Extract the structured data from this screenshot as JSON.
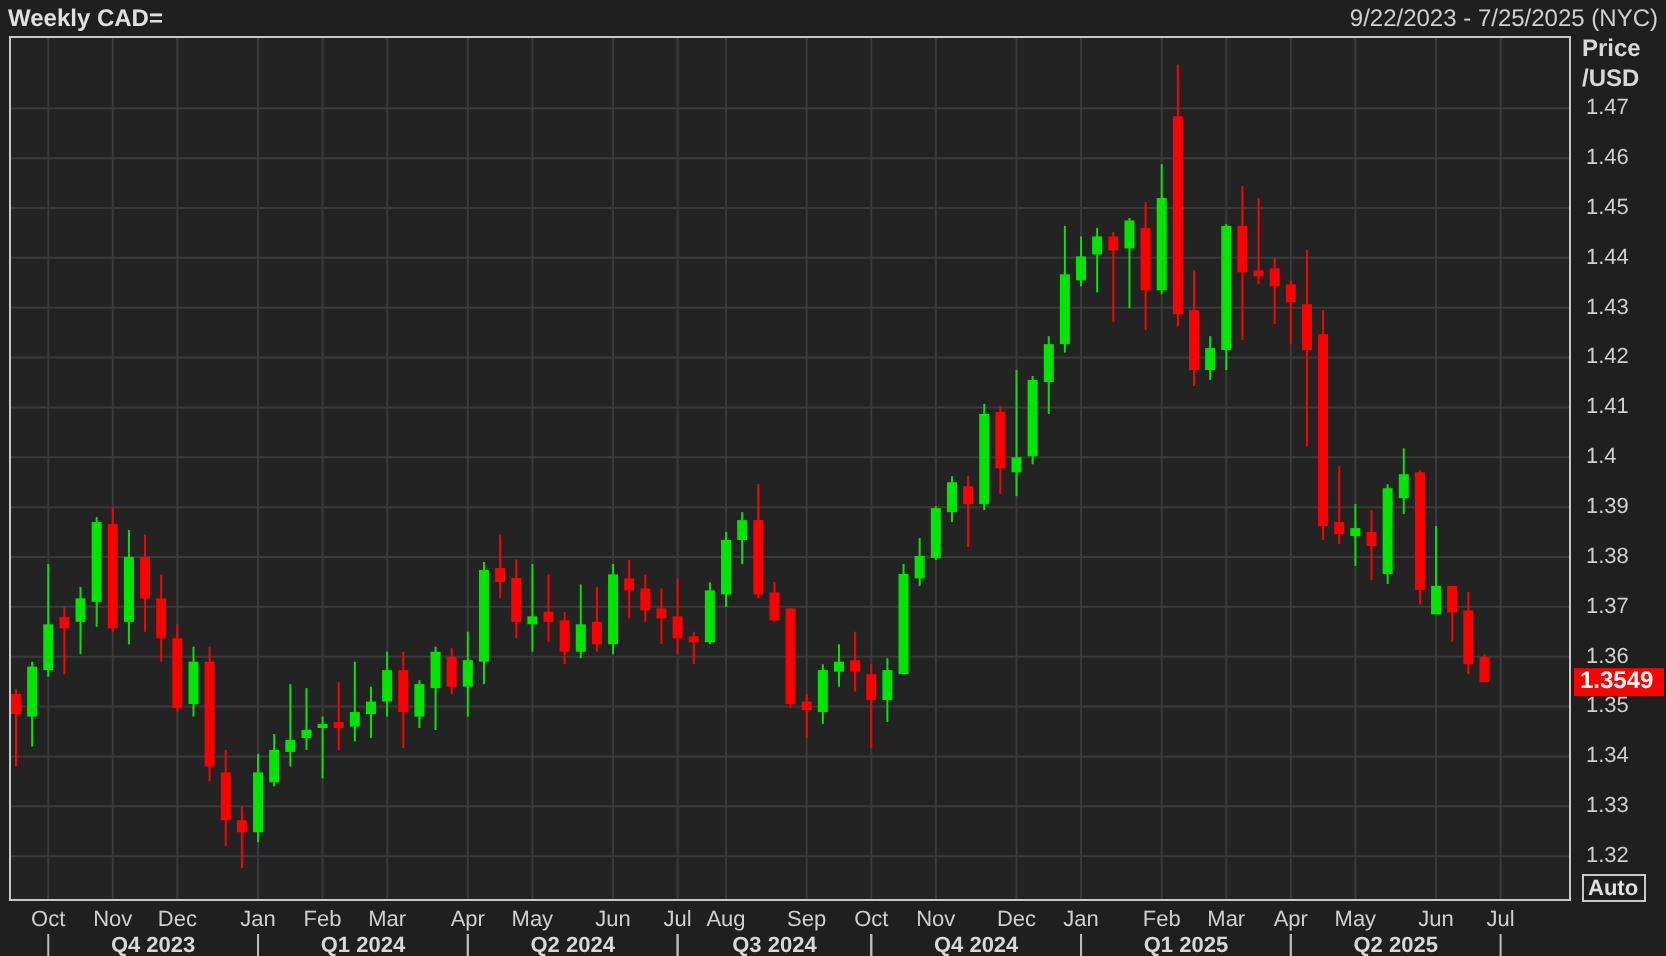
{
  "header": {
    "title": "Weekly CAD=",
    "date_range": "9/22/2023 - 7/25/2025 (NYC)"
  },
  "chart": {
    "auto_button": "Auto",
    "last_price": "1.3549",
    "quarters": [
      "Q4 2023",
      "Q1 2024",
      "Q2 2024",
      "Q3 2024",
      "Q4 2024",
      "Q1 2025",
      "Q2 2025"
    ],
    "chart_data": {
      "type": "candlestick",
      "ylabel": "Price /USD",
      "grid": true,
      "ylim": [
        1.3112,
        1.4845
      ],
      "yticks": [
        {
          "value": 1.32,
          "label": "1.32"
        },
        {
          "value": 1.33,
          "label": "1.33"
        },
        {
          "value": 1.34,
          "label": "1.34"
        },
        {
          "value": 1.35,
          "label": "1.35"
        },
        {
          "value": 1.36,
          "label": "1.36"
        },
        {
          "value": 1.37,
          "label": "1.37"
        },
        {
          "value": 1.38,
          "label": "1.38"
        },
        {
          "value": 1.39,
          "label": "1.39"
        },
        {
          "value": 1.4,
          "label": "1.4"
        },
        {
          "value": 1.41,
          "label": "1.41"
        },
        {
          "value": 1.42,
          "label": "1.42"
        },
        {
          "value": 1.43,
          "label": "1.43"
        },
        {
          "value": 1.44,
          "label": "1.44"
        },
        {
          "value": 1.45,
          "label": "1.45"
        },
        {
          "value": 1.46,
          "label": "1.46"
        },
        {
          "value": 1.47,
          "label": "1.47"
        }
      ],
      "categories": [
        null,
        null,
        "Oct",
        null,
        null,
        null,
        "Nov",
        null,
        null,
        null,
        "Dec",
        null,
        null,
        null,
        null,
        "Jan",
        null,
        null,
        null,
        "Feb",
        null,
        null,
        null,
        "Mar",
        null,
        null,
        null,
        null,
        "Apr",
        null,
        null,
        null,
        "May",
        null,
        null,
        null,
        null,
        "Jun",
        null,
        null,
        null,
        "Jul",
        null,
        null,
        "Aug",
        null,
        null,
        null,
        null,
        "Sep",
        null,
        null,
        null,
        "Oct",
        null,
        null,
        null,
        "Nov",
        null,
        null,
        null,
        null,
        "Dec",
        null,
        null,
        null,
        "Jan",
        null,
        null,
        null,
        null,
        "Feb",
        null,
        null,
        null,
        "Mar",
        null,
        null,
        null,
        "Apr",
        null,
        null,
        null,
        "May",
        null,
        null,
        null,
        null,
        "Jun",
        null,
        null,
        null,
        "Jul"
      ],
      "ohlc": [
        [
          1.3525,
          1.3535,
          1.338,
          1.3485
        ],
        [
          1.348,
          1.359,
          1.342,
          1.358
        ],
        [
          1.3573,
          1.3786,
          1.356,
          1.3665
        ],
        [
          1.368,
          1.37,
          1.3565,
          1.3657
        ],
        [
          1.367,
          1.374,
          1.3605,
          1.3717
        ],
        [
          1.371,
          1.388,
          1.366,
          1.387
        ],
        [
          1.3866,
          1.39,
          1.365,
          1.3657
        ],
        [
          1.367,
          1.3854,
          1.3625,
          1.38
        ],
        [
          1.38,
          1.3845,
          1.365,
          1.3717
        ],
        [
          1.3717,
          1.3765,
          1.359,
          1.3637
        ],
        [
          1.3637,
          1.3665,
          1.349,
          1.3497
        ],
        [
          1.3505,
          1.362,
          1.348,
          1.359
        ],
        [
          1.359,
          1.362,
          1.335,
          1.338
        ],
        [
          1.3368,
          1.3413,
          1.322,
          1.3272
        ],
        [
          1.3272,
          1.33,
          1.3176,
          1.3248
        ],
        [
          1.3248,
          1.3405,
          1.3228,
          1.3368
        ],
        [
          1.3348,
          1.3445,
          1.334,
          1.3413
        ],
        [
          1.3409,
          1.3545,
          1.338,
          1.3433
        ],
        [
          1.3437,
          1.3537,
          1.3413,
          1.3453
        ],
        [
          1.3457,
          1.348,
          1.3356,
          1.3465
        ],
        [
          1.3469,
          1.3549,
          1.3413,
          1.3457
        ],
        [
          1.346,
          1.359,
          1.343,
          1.3489
        ],
        [
          1.3485,
          1.354,
          1.3437,
          1.351
        ],
        [
          1.351,
          1.361,
          1.348,
          1.3573
        ],
        [
          1.3573,
          1.361,
          1.3417,
          1.3489
        ],
        [
          1.348,
          1.3553,
          1.3457,
          1.3545
        ],
        [
          1.3537,
          1.362,
          1.3453,
          1.361
        ],
        [
          1.36,
          1.3617,
          1.3525,
          1.354
        ],
        [
          1.354,
          1.365,
          1.348,
          1.3593
        ],
        [
          1.359,
          1.379,
          1.3545,
          1.3774
        ],
        [
          1.3778,
          1.3845,
          1.3717,
          1.375
        ],
        [
          1.3758,
          1.3795,
          1.3637,
          1.367
        ],
        [
          1.3665,
          1.3786,
          1.361,
          1.3681
        ],
        [
          1.369,
          1.3765,
          1.363,
          1.367
        ],
        [
          1.3673,
          1.369,
          1.3585,
          1.361
        ],
        [
          1.361,
          1.3745,
          1.3597,
          1.3665
        ],
        [
          1.367,
          1.374,
          1.361,
          1.3625
        ],
        [
          1.3625,
          1.3786,
          1.3605,
          1.3765
        ],
        [
          1.3757,
          1.3794,
          1.3677,
          1.3733
        ],
        [
          1.3737,
          1.3765,
          1.367,
          1.3693
        ],
        [
          1.3697,
          1.3737,
          1.3625,
          1.3677
        ],
        [
          1.3681,
          1.3757,
          1.3605,
          1.3637
        ],
        [
          1.3641,
          1.365,
          1.3585,
          1.3629
        ],
        [
          1.3629,
          1.3749,
          1.3625,
          1.3733
        ],
        [
          1.3725,
          1.385,
          1.37,
          1.3834
        ],
        [
          1.3834,
          1.389,
          1.3786,
          1.3874
        ],
        [
          1.3874,
          1.3946,
          1.3717,
          1.3725
        ],
        [
          1.3729,
          1.375,
          1.367,
          1.3673
        ],
        [
          1.3697,
          1.3697,
          1.3497,
          1.3505
        ],
        [
          1.351,
          1.3525,
          1.3437,
          1.3493
        ],
        [
          1.3489,
          1.3585,
          1.3465,
          1.3573
        ],
        [
          1.357,
          1.3625,
          1.354,
          1.359
        ],
        [
          1.3593,
          1.365,
          1.353,
          1.357
        ],
        [
          1.3565,
          1.3585,
          1.3417,
          1.3513
        ],
        [
          1.3513,
          1.3597,
          1.3469,
          1.3573
        ],
        [
          1.3565,
          1.3786,
          1.3565,
          1.3766
        ],
        [
          1.3757,
          1.3838,
          1.3742,
          1.3802
        ],
        [
          1.3798,
          1.3902,
          1.3794,
          1.3898
        ],
        [
          1.389,
          1.3962,
          1.387,
          1.395
        ],
        [
          1.3942,
          1.3962,
          1.382,
          1.3906
        ],
        [
          1.3906,
          1.4107,
          1.3894,
          1.4087
        ],
        [
          1.4091,
          1.4103,
          1.3926,
          1.3978
        ],
        [
          1.397,
          1.4175,
          1.3922,
          1.4
        ],
        [
          1.4002,
          1.4163,
          1.3986,
          1.4155
        ],
        [
          1.4151,
          1.4243,
          1.4087,
          1.4227
        ],
        [
          1.4227,
          1.4464,
          1.421,
          1.4367
        ],
        [
          1.4355,
          1.4443,
          1.4343,
          1.4403
        ],
        [
          1.4407,
          1.446,
          1.4331,
          1.4443
        ],
        [
          1.4443,
          1.4452,
          1.4271,
          1.4415
        ],
        [
          1.4419,
          1.448,
          1.4299,
          1.4475
        ],
        [
          1.446,
          1.4512,
          1.4255,
          1.4335
        ],
        [
          1.4335,
          1.4588,
          1.4327,
          1.452
        ],
        [
          1.4684,
          1.4788,
          1.4263,
          1.4287
        ],
        [
          1.4295,
          1.4375,
          1.4143,
          1.4175
        ],
        [
          1.4175,
          1.4243,
          1.4155,
          1.4219
        ],
        [
          1.4215,
          1.4468,
          1.4175,
          1.4464
        ],
        [
          1.4464,
          1.4544,
          1.4235,
          1.4371
        ],
        [
          1.4375,
          1.452,
          1.4347,
          1.4363
        ],
        [
          1.4379,
          1.44,
          1.4267,
          1.4343
        ],
        [
          1.4347,
          1.4355,
          1.4227,
          1.4311
        ],
        [
          1.4307,
          1.4416,
          1.4022,
          1.4215
        ],
        [
          1.4247,
          1.4295,
          1.3834,
          1.3862
        ],
        [
          1.387,
          1.3982,
          1.3826,
          1.3846
        ],
        [
          1.3842,
          1.3906,
          1.3782,
          1.3858
        ],
        [
          1.385,
          1.3894,
          1.3754,
          1.3822
        ],
        [
          1.3766,
          1.3946,
          1.3746,
          1.3938
        ],
        [
          1.3918,
          1.4018,
          1.3886,
          1.3966
        ],
        [
          1.397,
          1.3974,
          1.3705,
          1.3734
        ],
        [
          1.3685,
          1.3862,
          1.3685,
          1.3742
        ],
        [
          1.3742,
          1.3742,
          1.363,
          1.3689
        ],
        [
          1.3693,
          1.373,
          1.3565,
          1.3585
        ],
        [
          1.36,
          1.3605,
          1.3549,
          1.3549
        ],
        null
      ]
    }
  }
}
